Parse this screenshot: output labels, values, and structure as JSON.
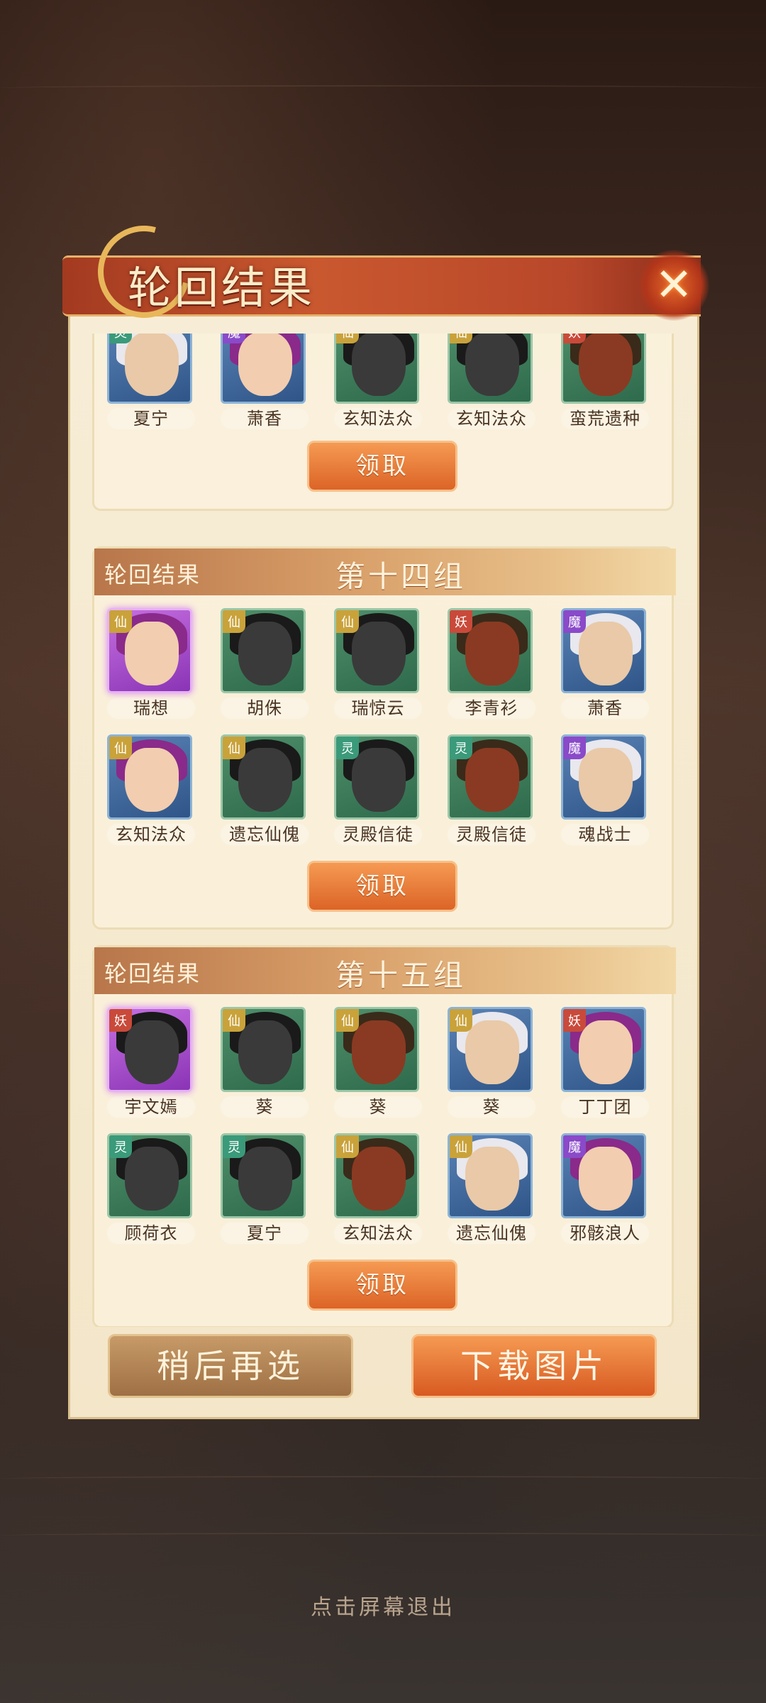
{
  "dialog": {
    "title": "轮回结果",
    "close_icon": "close-icon"
  },
  "groups": [
    {
      "banner_left": "",
      "title": "",
      "cards": [
        {
          "tag": "灵",
          "name": "夏宁"
        },
        {
          "tag": "魔",
          "name": "萧香"
        },
        {
          "tag": "仙",
          "name": "玄知法众"
        },
        {
          "tag": "仙",
          "name": "玄知法众"
        },
        {
          "tag": "妖",
          "name": "蛮荒遗种"
        }
      ],
      "claim_label": "领取"
    },
    {
      "banner_left": "轮回结果",
      "title": "第十四组",
      "cards": [
        {
          "tag": "仙",
          "name": "瑞想"
        },
        {
          "tag": "仙",
          "name": "胡侏"
        },
        {
          "tag": "仙",
          "name": "瑞惊云"
        },
        {
          "tag": "妖",
          "name": "李青衫"
        },
        {
          "tag": "魔",
          "name": "萧香"
        },
        {
          "tag": "仙",
          "name": "玄知法众"
        },
        {
          "tag": "仙",
          "name": "遗忘仙傀"
        },
        {
          "tag": "灵",
          "name": "灵殿信徒"
        },
        {
          "tag": "灵",
          "name": "灵殿信徒"
        },
        {
          "tag": "魔",
          "name": "魂战士"
        }
      ],
      "claim_label": "领取"
    },
    {
      "banner_left": "轮回结果",
      "title": "第十五组",
      "cards": [
        {
          "tag": "妖",
          "name": "宇文嫣"
        },
        {
          "tag": "仙",
          "name": "葵"
        },
        {
          "tag": "仙",
          "name": "葵"
        },
        {
          "tag": "仙",
          "name": "葵"
        },
        {
          "tag": "妖",
          "name": "丁丁团"
        },
        {
          "tag": "灵",
          "name": "顾荷衣"
        },
        {
          "tag": "灵",
          "name": "夏宁"
        },
        {
          "tag": "仙",
          "name": "玄知法众"
        },
        {
          "tag": "仙",
          "name": "遗忘仙傀"
        },
        {
          "tag": "魔",
          "name": "邪骸浪人"
        }
      ],
      "claim_label": "领取"
    }
  ],
  "actions": {
    "later_label": "稍后再选",
    "download_label": "下载图片"
  },
  "exit_hint": "点击屏幕退出"
}
